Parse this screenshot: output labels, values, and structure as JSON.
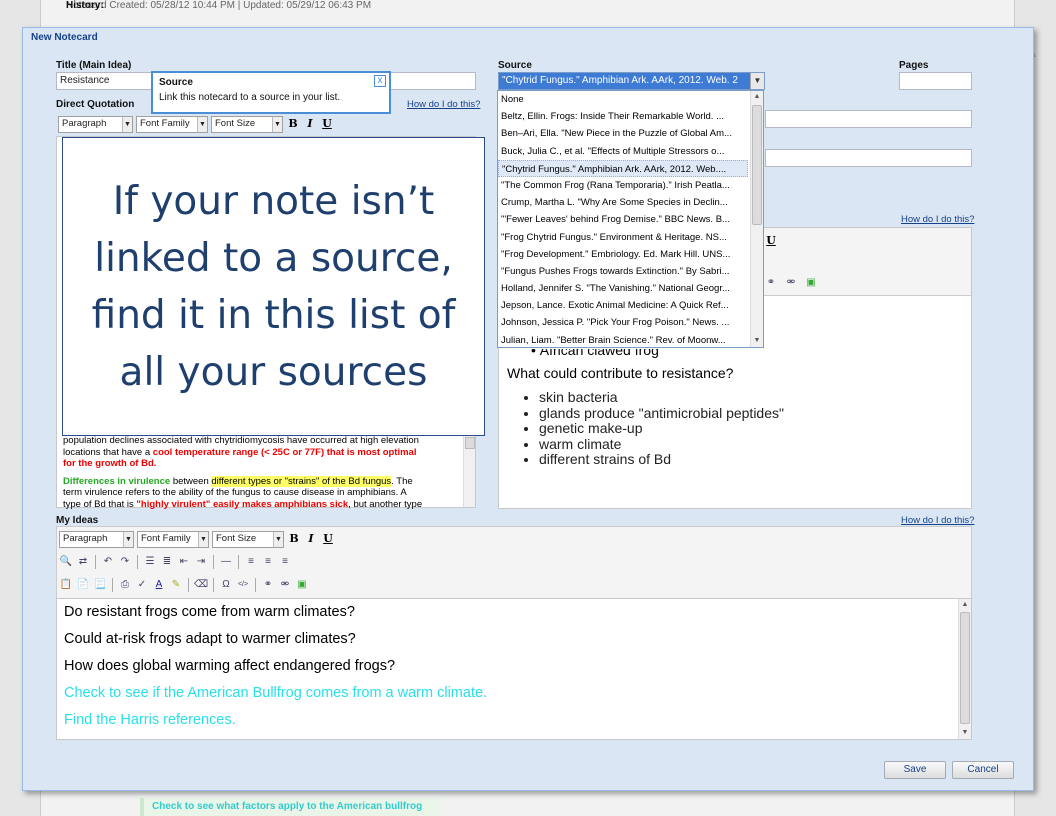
{
  "background": {
    "history_label": "History:",
    "history_value": "Notecard Created: 05/28/12 10:44 PM | Updated: 05/29/12 06:43 PM",
    "bottom_note": "Check to see what factors apply to the American bullfrog"
  },
  "dialog": {
    "title": "New Notecard",
    "title_label": "Title (Main Idea)",
    "title_value": "Resistance",
    "direct_quotation_label": "Direct Quotation",
    "how_link": "How do I do this?",
    "source_label": "Source",
    "source_selected": "\"Chytrid Fungus.\" Amphibian Ark. AArk, 2012. Web. 2",
    "pages_label": "Pages",
    "my_ideas_label": "My Ideas",
    "save_label": "Save",
    "cancel_label": "Cancel"
  },
  "toolbar": {
    "paragraph": "Paragraph",
    "font_family": "Font Family",
    "font_size": "Font Size",
    "bold": "B",
    "italic": "I",
    "underline": "U"
  },
  "tooltip": {
    "title": "Source",
    "body": "Link this notecard to a source in your list.",
    "close": "x"
  },
  "callout": {
    "text": "If your note isn’t\nlinked to a source,\nfind it in this list of\nall your sources"
  },
  "source_options": [
    "None",
    "Beltz, Ellin. Frogs: Inside Their Remarkable World. ...",
    "Ben–Ari, Ella. \"New Piece in the Puzzle of Global Am...",
    "Buck, Julia C., et al. \"Effects of Multiple Stressors o...",
    "\"Chytrid Fungus.\" Amphibian Ark. AArk, 2012. Web....",
    "\"The Common Frog (Rana Temporaria).\" Irish Peatla...",
    "Crump, Martha L. \"Why Are Some Species in Declin...",
    "\"'Fewer Leaves' behind Frog Demise.\" BBC News. B...",
    "\"Frog Chytrid Fungus.\" Environment & Heritage. NS...",
    "\"Frog Development.\" Embriology. Ed. Mark Hill. UNS...",
    "\"Fungus Pushes Frogs towards Extinction.\" By Sabri...",
    "Holland, Jennifer S. \"The Vanishing.\" National Geogr...",
    "Jepson, Lance. Exotic Animal Medicine: A Quick Ref...",
    "Johnson, Jessica P. \"Pick Your Frog Poison.\" News. ...",
    "Julian, Liam. \"Better Brain Science.\" Rev. of Moonw..."
  ],
  "quotation": {
    "line1_a": "population declines associated with chytridiomycosis have occurred at high elevation",
    "line2_a": "locations that have a ",
    "line2_red": "cool temperature range (< 25C or 77F) that is most optimal",
    "line3_red": "for the growth of Bd.",
    "line4_green": "Differences in virulence",
    "line4_a": " between ",
    "line4_hl": "different types or \"strains\" of the Bd fungus",
    "line4_b": ". The",
    "line5": "term virulence refers to the ability of the fungus to cause disease in amphibians. A",
    "line6_a": "type of Bd that is ",
    "line6_red": "\"highly virulent\" easily makes amphibians sick",
    "line6_b": ", but another type"
  },
  "notes": {
    "partial_item": "African clawed frog",
    "question": "What could contribute to resistance?",
    "items": [
      "skin bacteria",
      "glands produce \"antimicrobial peptides\"",
      "genetic make-up",
      "warm climate",
      "different strains of Bd"
    ]
  },
  "my_ideas": {
    "lines": [
      "Do resistant frogs come from warm climates?",
      "Could at-risk frogs adapt to warmer climates?",
      "How does global warming affect endangered frogs?",
      "Check to see if the American Bullfrog comes from a warm climate.",
      "Find the Harris references."
    ]
  },
  "colors": {
    "dialog_bg": "#dbe6f4",
    "link": "#15428b",
    "callout_text": "#1f3f6e",
    "cyan_text": "#29e0e8",
    "highlight_red": "#ee0000"
  }
}
